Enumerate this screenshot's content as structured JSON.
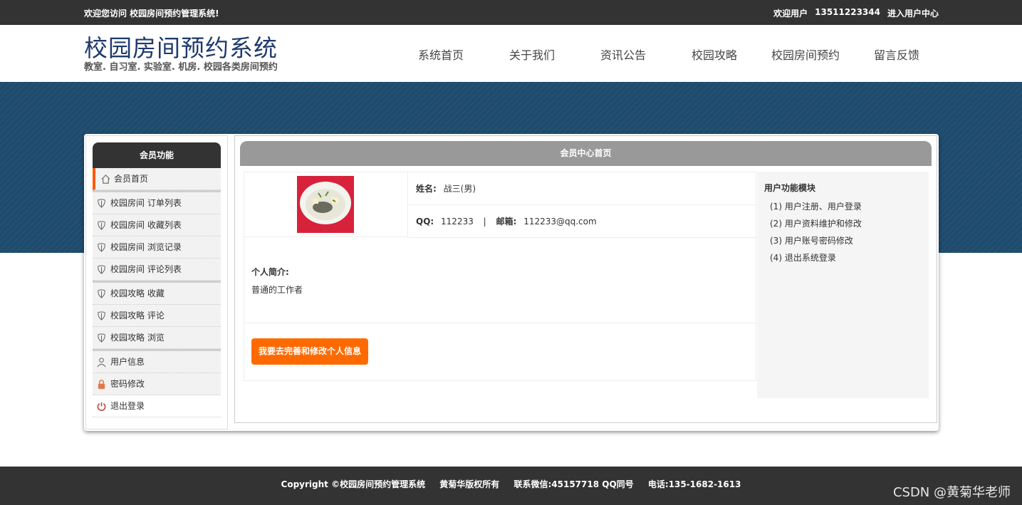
{
  "topbar": {
    "welcome": "欢迎您访问 校园房间预约管理系统!",
    "user_label": "欢迎用户",
    "phone": "13511223344",
    "center_link": "进入用户中心"
  },
  "header": {
    "title": "校园房间预约系统",
    "subtitle": "教室. 自习室. 实验室. 机房. 校园各类房间预约"
  },
  "nav": [
    "系统首页",
    "关于我们",
    "资讯公告",
    "校园攻略",
    "校园房间预约",
    "留言反馈"
  ],
  "sidebar": {
    "title": "会员功能",
    "items": [
      {
        "label": "会员首页",
        "icon": "home-icon"
      },
      {
        "label": "校园房间 订单列表",
        "icon": "flower-icon"
      },
      {
        "label": "校园房间 收藏列表",
        "icon": "flower-icon"
      },
      {
        "label": "校园房间 浏览记录",
        "icon": "flower-icon"
      },
      {
        "label": "校园房间 评论列表",
        "icon": "flower-icon"
      },
      {
        "label": "校园攻略 收藏",
        "icon": "flower-icon"
      },
      {
        "label": "校园攻略 评论",
        "icon": "flower-icon"
      },
      {
        "label": "校园攻略 浏览",
        "icon": "flower-icon"
      },
      {
        "label": "用户信息",
        "icon": "user-icon"
      },
      {
        "label": "密码修改",
        "icon": "lock-icon"
      },
      {
        "label": "退出登录",
        "icon": "power-icon"
      }
    ]
  },
  "main": {
    "title": "会员中心首页",
    "name_label": "姓名:",
    "name_value": "战三(男)",
    "qq_label": "QQ:",
    "qq_value": "112233",
    "separator": "|",
    "email_label": "邮箱:",
    "email_value": "112233@qq.com",
    "intro_label": "个人简介:",
    "intro_value": "普通的工作者",
    "edit_button": "我要去完善和修改个人信息"
  },
  "functions": {
    "title": "用户功能模块",
    "items": [
      "(1) 用户注册、用户登录",
      "(2) 用户资料维护和修改",
      "(3) 用户账号密码修改",
      "(4) 退出系统登录"
    ]
  },
  "footer": {
    "copyright": "Copyright ©校园房间预约管理系统",
    "owner": "黄菊华版权所有",
    "wechat": "联系微信:45157718 QQ同号",
    "phone": "电话:135-1682-1613",
    "watermark": "CSDN @黄菊华老师"
  },
  "colors": {
    "accent": "#ff6a00",
    "banner": "#1f4a6b",
    "dark": "#333333"
  }
}
